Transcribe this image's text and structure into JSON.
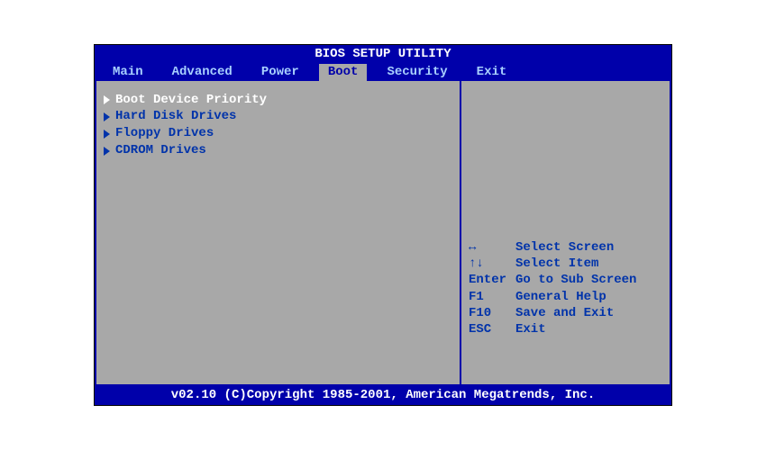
{
  "title": "BIOS SETUP UTILITY",
  "tabs": [
    {
      "label": "Main",
      "selected": false
    },
    {
      "label": "Advanced",
      "selected": false
    },
    {
      "label": "Power",
      "selected": false
    },
    {
      "label": "Boot",
      "selected": true
    },
    {
      "label": "Security",
      "selected": false
    },
    {
      "label": "Exit",
      "selected": false
    }
  ],
  "menu": [
    {
      "label": "Boot Device Priority",
      "selected": true
    },
    {
      "label": "Hard Disk Drives",
      "selected": false
    },
    {
      "label": "Floppy Drives",
      "selected": false
    },
    {
      "label": "CDROM Drives",
      "selected": false
    }
  ],
  "hints": [
    {
      "key": "↔",
      "action": "Select Screen"
    },
    {
      "key": "↑↓",
      "action": "Select Item"
    },
    {
      "key": "Enter",
      "action": "Go to Sub Screen"
    },
    {
      "key": "F1",
      "action": "General Help"
    },
    {
      "key": "F10",
      "action": "Save and Exit"
    },
    {
      "key": "ESC",
      "action": "Exit"
    }
  ],
  "footer": "v02.10 (C)Copyright 1985-2001, American Megatrends, Inc."
}
